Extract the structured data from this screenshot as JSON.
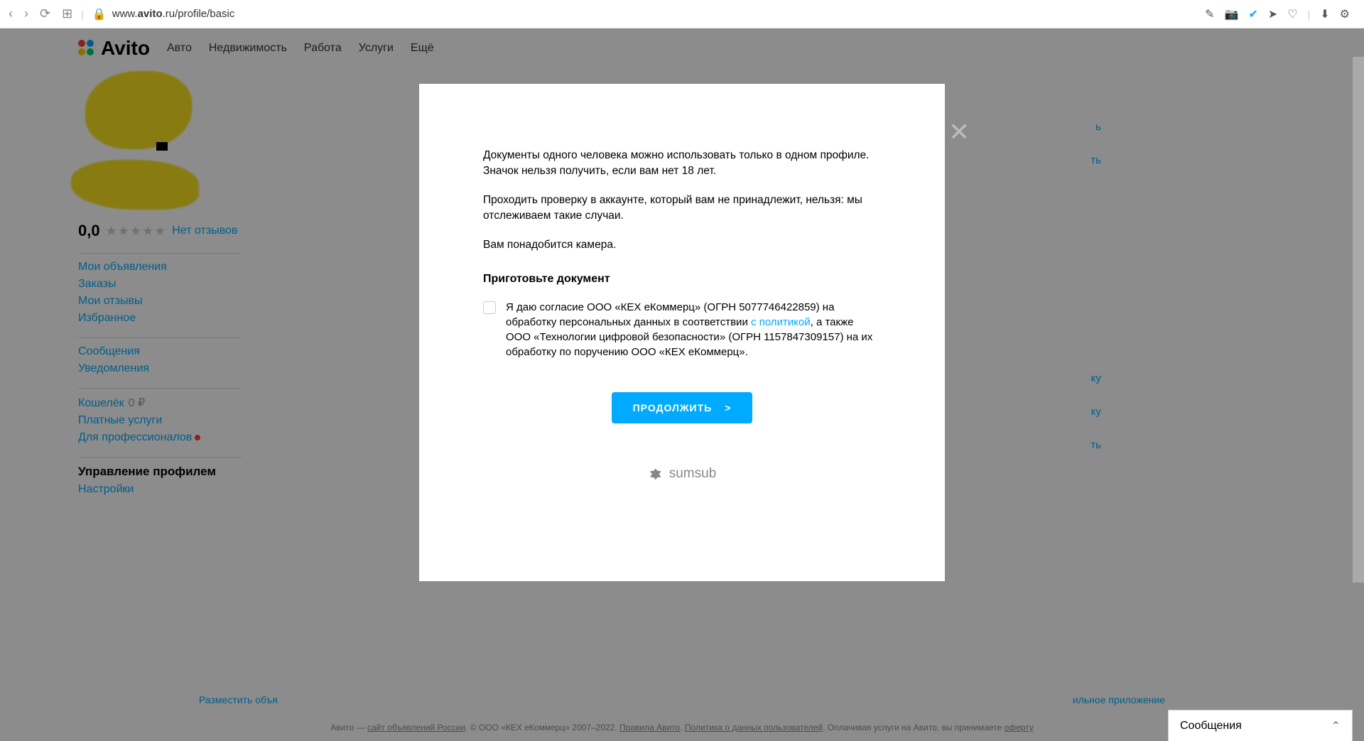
{
  "browser": {
    "url_prefix": "www.",
    "url_domain": "avito",
    "url_suffix": ".ru/profile/basic"
  },
  "header": {
    "logo": "Avito",
    "nav": [
      "Авто",
      "Недвижимость",
      "Работа",
      "Услуги",
      "Ещё"
    ]
  },
  "sidebar": {
    "rating": "0,0",
    "stars": "★★★★★",
    "reviews": "Нет отзывов",
    "group1": [
      "Мои объявления",
      "Заказы",
      "Мои отзывы",
      "Избранное"
    ],
    "group2": [
      "Сообщения",
      "Уведомления"
    ],
    "wallet_label": "Кошелёк",
    "wallet_amount": "0 ₽",
    "paid": "Платные услуги",
    "pro": "Для профессионалов",
    "manage": "Управление профилем",
    "settings": "Настройки"
  },
  "right_links": [
    "ь",
    "ть",
    "ку",
    "ку",
    "ть"
  ],
  "modal": {
    "p1": "Документы одного человека можно использовать только в одном профиле. Значок нельзя получить, если вам нет 18 лет.",
    "p2": "Проходить проверку в аккаунте, который вам не принадлежит, нельзя: мы отслеживаем такие случаи.",
    "p3": "Вам понадобится камера.",
    "heading": "Приготовьте документ",
    "consent_pre": "Я даю согласие ООО «КЕХ еКоммерц» (ОГРН 5077746422859) на обработку персональных данных в соответствии ",
    "consent_link": "с политикой",
    "consent_post": ", а также ООО «Технологии цифровой безопасности» (ОГРН 1157847309157) на их обработку по поручению ООО «КЕХ еКоммерц».",
    "button": "ПРОДОЛЖИТЬ",
    "arrow": ">",
    "sumsub": "sumsub"
  },
  "footer": {
    "left": "Разместить объя",
    "right": "ильное приложение",
    "bot_pre": "Авито — ",
    "bot_site": "сайт объявлений России",
    "bot_copy": ". © ООО «КЕХ еКоммерц» 2007–2022. ",
    "bot_rules": "Правила Авито",
    "bot_dot": ". ",
    "bot_policy": "Политика о данных пользователей",
    "bot_offer_pre": ". Оплачивая услуги на Авито, вы принимаете ",
    "bot_offer": "оферту"
  },
  "messages": {
    "label": "Сообщения"
  }
}
